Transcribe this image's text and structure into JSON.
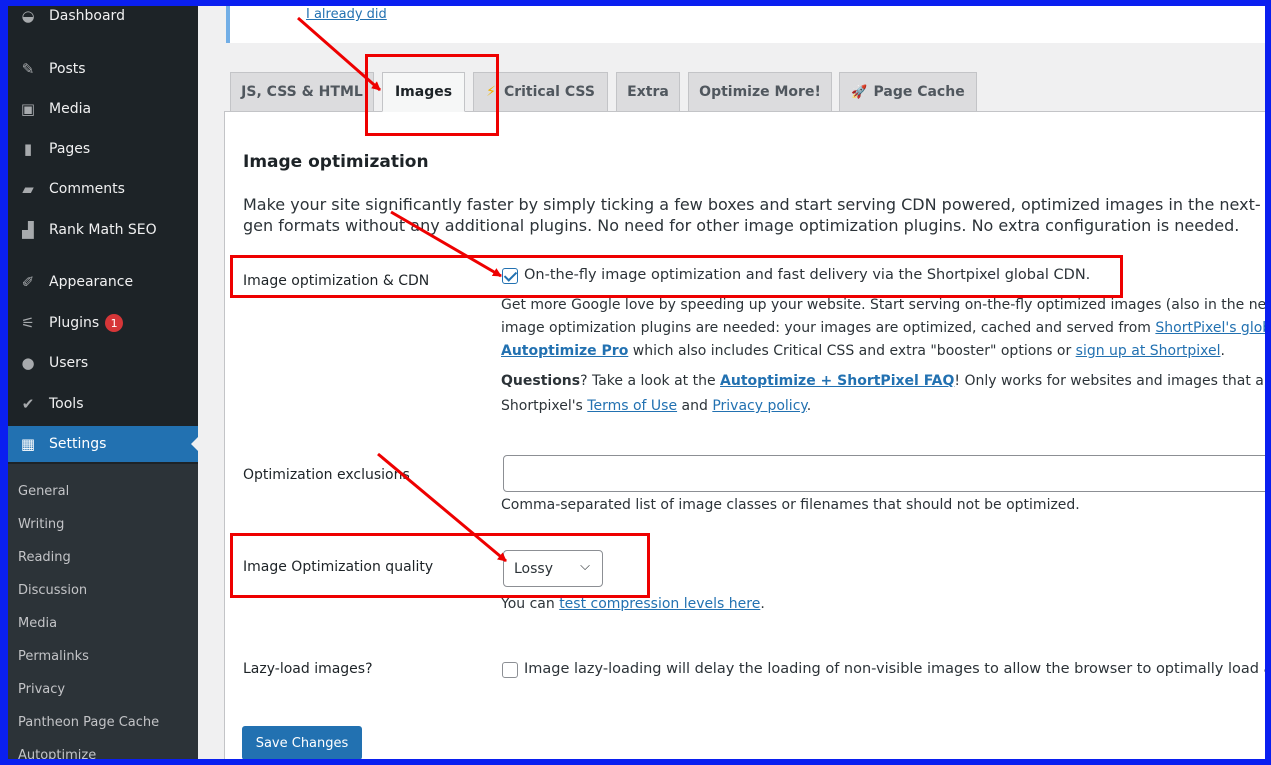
{
  "sidebar": {
    "items": [
      {
        "label": "Dashboard",
        "icon": "dashboard-icon",
        "glyph": "◒"
      },
      {
        "label": "Posts",
        "icon": "pin-icon",
        "glyph": "✎"
      },
      {
        "label": "Media",
        "icon": "media-icon",
        "glyph": "▣"
      },
      {
        "label": "Pages",
        "icon": "pages-icon",
        "glyph": "▮"
      },
      {
        "label": "Comments",
        "icon": "comment-icon",
        "glyph": "▰"
      },
      {
        "label": "Rank Math SEO",
        "icon": "rank-math-icon",
        "glyph": "▟"
      },
      {
        "label": "Appearance",
        "icon": "brush-icon",
        "glyph": "✐"
      },
      {
        "label": "Plugins",
        "icon": "plug-icon",
        "glyph": "⚟",
        "badge": "1"
      },
      {
        "label": "Users",
        "icon": "users-icon",
        "glyph": "●"
      },
      {
        "label": "Tools",
        "icon": "wrench-icon",
        "glyph": "✔"
      },
      {
        "label": "Settings",
        "icon": "settings-icon",
        "glyph": "▦"
      }
    ],
    "submenu": [
      "General",
      "Writing",
      "Reading",
      "Discussion",
      "Media",
      "Permalinks",
      "Privacy",
      "Pantheon Page Cache",
      "Autoptimize"
    ]
  },
  "notice": {
    "link": "I already did"
  },
  "tabs": [
    {
      "label": "JS, CSS & HTML",
      "icon": ""
    },
    {
      "label": "Images",
      "icon": "",
      "active": true
    },
    {
      "label": "Critical CSS",
      "icon": "⚡"
    },
    {
      "label": "Extra",
      "icon": ""
    },
    {
      "label": "Optimize More!",
      "icon": ""
    },
    {
      "label": "Page Cache",
      "icon": "🚀"
    }
  ],
  "main": {
    "heading": "Image optimization",
    "intro": "Make your site significantly faster by simply ticking a few boxes and start serving CDN powered, optimized images in the next-gen formats without any additional plugins. No need for other image optimization plugins. No extra configuration is needed.",
    "cdn": {
      "label": "Image optimization & CDN",
      "checkbox_label": "On-the-fly image optimization and fast delivery via the Shortpixel global CDN.",
      "checked": true,
      "line1": "Get more Google love by speeding up your website. Start serving on-the-fly optimized images (also in the next-gen formats) and no other",
      "line2_pre": "image optimization plugins are needed: your images are optimized, cached and served from ",
      "line2_link": "ShortPixel's global CDN",
      "line3_link1": "Autoptimize Pro",
      "line3_mid": " which also includes Critical CSS and extra \"booster\" options or ",
      "line3_link2": "sign up at Shortpixel",
      "line3_end": ".",
      "line4_bold": "Questions",
      "line4_pre": "? Take a look at the ",
      "line4_link": "Autoptimize + ShortPixel FAQ",
      "line4_post": "! Only works for websites and images that are publicly available. By enabling you agree to",
      "line5_pre": "Shortpixel's ",
      "line5_link1": "Terms of Use",
      "line5_mid": " and ",
      "line5_link2": "Privacy policy",
      "line5_end": "."
    },
    "exclusions": {
      "label": "Optimization exclusions",
      "value": "",
      "help": "Comma-separated list of image classes or filenames that should not be optimized."
    },
    "quality": {
      "label": "Image Optimization quality",
      "selected": "Lossy",
      "help_pre": "You can ",
      "help_link": "test compression levels here",
      "help_end": "."
    },
    "lazy": {
      "label": "Lazy-load images?",
      "checkbox_label": "Image lazy-loading will delay the loading of non-visible images to allow the browser to optimally load all resources for the above-the-fold page first.",
      "checked": false
    },
    "save": "Save Changes"
  },
  "colors": {
    "annotation": "#ee0000",
    "accent": "#2271b1",
    "sidebar": "#1d2327"
  }
}
